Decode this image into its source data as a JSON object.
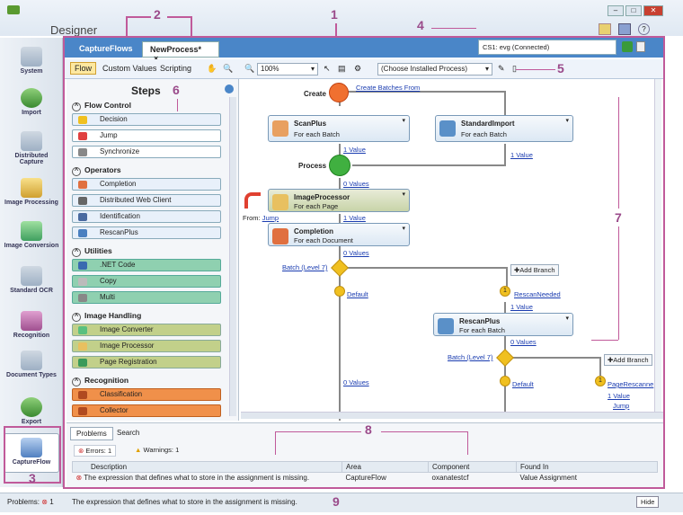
{
  "app": {
    "title": "Designer"
  },
  "window": {
    "min": "–",
    "max": "□",
    "close": "✕"
  },
  "leftnav": [
    "System",
    "Import",
    "Distributed Capture",
    "Image Processing",
    "Image Conversion",
    "Standard OCR",
    "Recognition",
    "Document Types",
    "Export",
    "CaptureFlow"
  ],
  "tabs": [
    "CaptureFlows",
    "NewProcess*"
  ],
  "tab_close": "×",
  "connection": "CS1: evg (Connected)",
  "toolbar": {
    "flow": "Flow",
    "custom": "Custom Values",
    "scripting": "Scripting",
    "zoom": "100%",
    "process": "(Choose Installed Process)"
  },
  "steps": {
    "title": "Steps",
    "cats": [
      {
        "name": "Flow Control",
        "items": [
          "Decision",
          "Jump",
          "Synchronize"
        ]
      },
      {
        "name": "Operators",
        "items": [
          "Completion",
          "Distributed Web Client",
          "Identification",
          "RescanPlus"
        ]
      },
      {
        "name": "Utilities",
        "items": [
          ".NET Code",
          "Copy",
          "Multi"
        ]
      },
      {
        "name": "Image Handling",
        "items": [
          "Image Converter",
          "Image Processor",
          "Page Registration"
        ]
      },
      {
        "name": "Recognition",
        "items": [
          "Classification",
          "Collector"
        ]
      }
    ]
  },
  "flow": {
    "create": "Create",
    "create_link": "Create Batches From",
    "process": "Process",
    "scanplus": "ScanPlus",
    "scanplus_sub": "For each Batch",
    "std": "StandardImport",
    "std_sub": "For each Batch",
    "one_value": "1 Value",
    "zero_values": "0 Values",
    "ip": "ImageProcessor",
    "ip_sub": "For each Page",
    "from": "From:",
    "jump": "Jump",
    "completion": "Completion",
    "completion_sub": "For each Document",
    "batch7": "Batch (Level 7)",
    "add_branch": "Add Branch",
    "default": "Default",
    "rescan_needed": "RescanNeeded",
    "rescanplus": "RescanPlus",
    "rescanplus_sub": "For each Batch",
    "page_rescan": "PageRescanne",
    "one": "1"
  },
  "problems": {
    "tabs": [
      "Problems",
      "Search"
    ],
    "errors": "Errors: 1",
    "warnings": "Warnings: 1",
    "headers": [
      "Description",
      "Area",
      "Component",
      "Found In"
    ],
    "row": [
      "The expression that defines what to store in the assignment is missing.",
      "CaptureFlow",
      "oxanatestcf",
      "Value Assignment"
    ]
  },
  "status": {
    "label": "Problems:",
    "count": "1",
    "message": "The expression that defines what to store in the assignment is missing.",
    "hide": "Hide"
  },
  "callouts": [
    "1",
    "2",
    "3",
    "4",
    "5",
    "6",
    "7",
    "8",
    "9"
  ]
}
